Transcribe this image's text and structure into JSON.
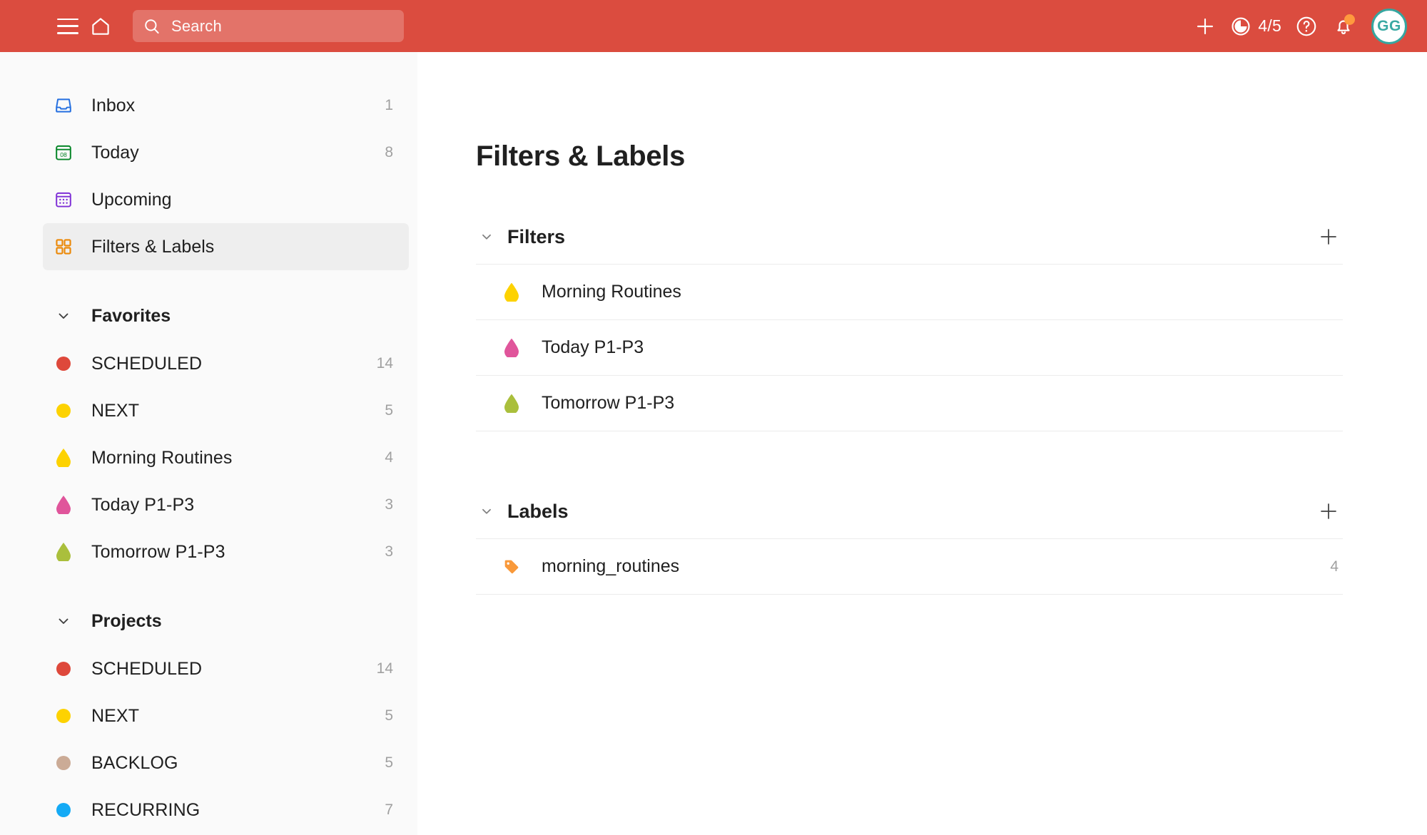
{
  "header": {
    "menu_icon": "hamburger-icon",
    "home_icon": "home-icon",
    "search": {
      "placeholder": "Search",
      "value": "",
      "icon": "search-icon"
    },
    "add_icon": "plus-icon",
    "karma": {
      "label": "4/5",
      "icon": "productivity-circle-icon"
    },
    "help_icon": "help-circle-icon",
    "notifications": {
      "icon": "bell-icon",
      "has_unread": true,
      "dot_color": "#ff9a3e"
    },
    "avatar": {
      "initials": "GG",
      "ring_color": "#36a6a0"
    },
    "background_color": "#db4c3f"
  },
  "sidebar": {
    "nav": [
      {
        "label": "Inbox",
        "count": "1",
        "icon": "inbox-icon",
        "color": "#246fe0",
        "selected": false
      },
      {
        "label": "Today",
        "count": "8",
        "icon": "calendar-today-icon",
        "color": "#058527",
        "selected": false
      },
      {
        "label": "Upcoming",
        "count": "",
        "icon": "calendar-upcoming-icon",
        "color": "#7f30d6",
        "selected": false
      },
      {
        "label": "Filters & Labels",
        "count": "",
        "icon": "filters-labels-icon",
        "color": "#eb8909",
        "selected": true
      }
    ],
    "favorites": {
      "title": "Favorites",
      "chevron": "chevron-down-icon",
      "items": [
        {
          "label": "SCHEDULED",
          "count": "14",
          "icon": "dot",
          "color": "#de483b"
        },
        {
          "label": "NEXT",
          "count": "5",
          "icon": "dot",
          "color": "#fdd201"
        },
        {
          "label": "Morning Routines",
          "count": "4",
          "icon": "droplet",
          "color": "#fdd201"
        },
        {
          "label": "Today P1-P3",
          "count": "3",
          "icon": "droplet",
          "color": "#e0559b"
        },
        {
          "label": "Tomorrow P1-P3",
          "count": "3",
          "icon": "droplet",
          "color": "#aabf3c"
        }
      ]
    },
    "projects": {
      "title": "Projects",
      "chevron": "chevron-down-icon",
      "items": [
        {
          "label": "SCHEDULED",
          "count": "14",
          "icon": "dot",
          "color": "#de483b"
        },
        {
          "label": "NEXT",
          "count": "5",
          "icon": "dot",
          "color": "#fdd201"
        },
        {
          "label": "BACKLOG",
          "count": "5",
          "icon": "dot",
          "color": "#cbab96"
        },
        {
          "label": "RECURRING",
          "count": "7",
          "icon": "dot",
          "color": "#14aaf5"
        }
      ]
    }
  },
  "main": {
    "title": "Filters & Labels",
    "filters": {
      "heading": "Filters",
      "chevron": "chevron-down-icon",
      "add_icon": "plus-icon",
      "items": [
        {
          "label": "Morning Routines",
          "count": "",
          "icon": "droplet",
          "color": "#fdd201"
        },
        {
          "label": "Today P1-P3",
          "count": "",
          "icon": "droplet",
          "color": "#e0559b"
        },
        {
          "label": "Tomorrow P1-P3",
          "count": "",
          "icon": "droplet",
          "color": "#aabf3c"
        }
      ]
    },
    "labels": {
      "heading": "Labels",
      "chevron": "chevron-down-icon",
      "add_icon": "plus-icon",
      "items": [
        {
          "label": "morning_routines",
          "count": "4",
          "icon": "tag",
          "color": "#f9993a"
        }
      ]
    }
  }
}
